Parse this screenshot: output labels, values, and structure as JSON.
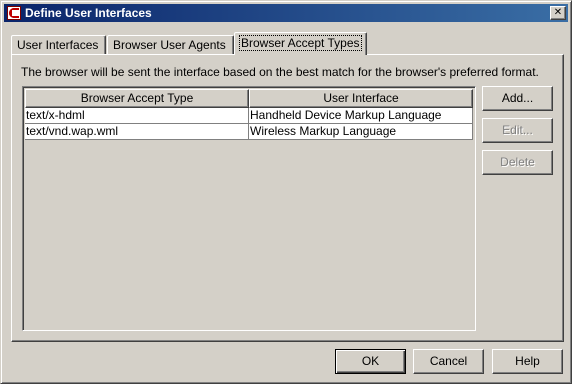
{
  "window": {
    "title": "Define User Interfaces",
    "close_glyph": "✕"
  },
  "tabs": [
    {
      "label": "User Interfaces",
      "active": false
    },
    {
      "label": "Browser User Agents",
      "active": false
    },
    {
      "label": "Browser Accept Types",
      "active": true
    }
  ],
  "panel": {
    "description": "The browser will be sent the interface based on the best match for the browser's preferred format."
  },
  "table": {
    "columns": [
      "Browser Accept Type",
      "User Interface"
    ],
    "rows": [
      [
        "text/x-hdml",
        "Handheld Device Markup Language"
      ],
      [
        "text/vnd.wap.wml",
        "Wireless Markup Language"
      ]
    ]
  },
  "side_buttons": {
    "add": "Add...",
    "edit": "Edit...",
    "delete": "Delete"
  },
  "footer_buttons": {
    "ok": "OK",
    "cancel": "Cancel",
    "help": "Help"
  }
}
